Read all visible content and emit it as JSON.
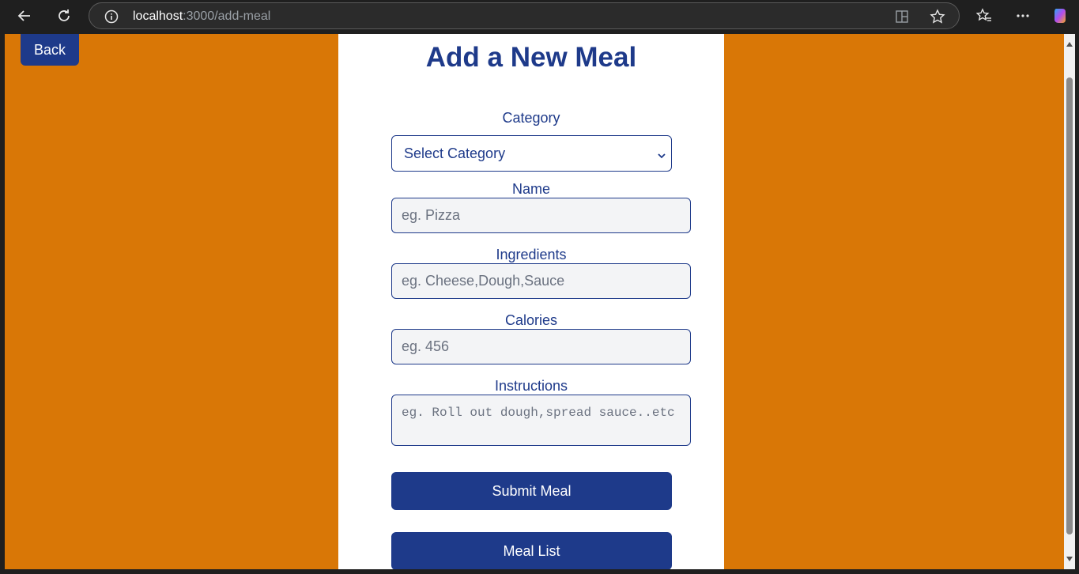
{
  "browser": {
    "url_host": "localhost",
    "url_path": ":3000/add-meal",
    "icons": [
      "back-arrow-icon",
      "reload-icon",
      "info-icon",
      "split-screen-icon",
      "star-icon",
      "favorites-icon",
      "more-icon",
      "copilot-icon"
    ]
  },
  "page": {
    "back_label": "Back",
    "title": "Add a New Meal",
    "category": {
      "label": "Category",
      "selected": "Select Category"
    },
    "name": {
      "label": "Name",
      "placeholder": "eg. Pizza"
    },
    "ingredients": {
      "label": "Ingredients",
      "placeholder": "eg. Cheese,Dough,Sauce"
    },
    "calories": {
      "label": "Calories",
      "placeholder": "eg. 456"
    },
    "instructions": {
      "label": "Instructions",
      "placeholder": "eg. Roll out dough,spread sauce..etc"
    },
    "submit_label": "Submit Meal",
    "meal_list_label": "Meal List"
  },
  "colors": {
    "background": "#d97706",
    "accent": "#1e3a8a",
    "card": "#ffffff"
  }
}
